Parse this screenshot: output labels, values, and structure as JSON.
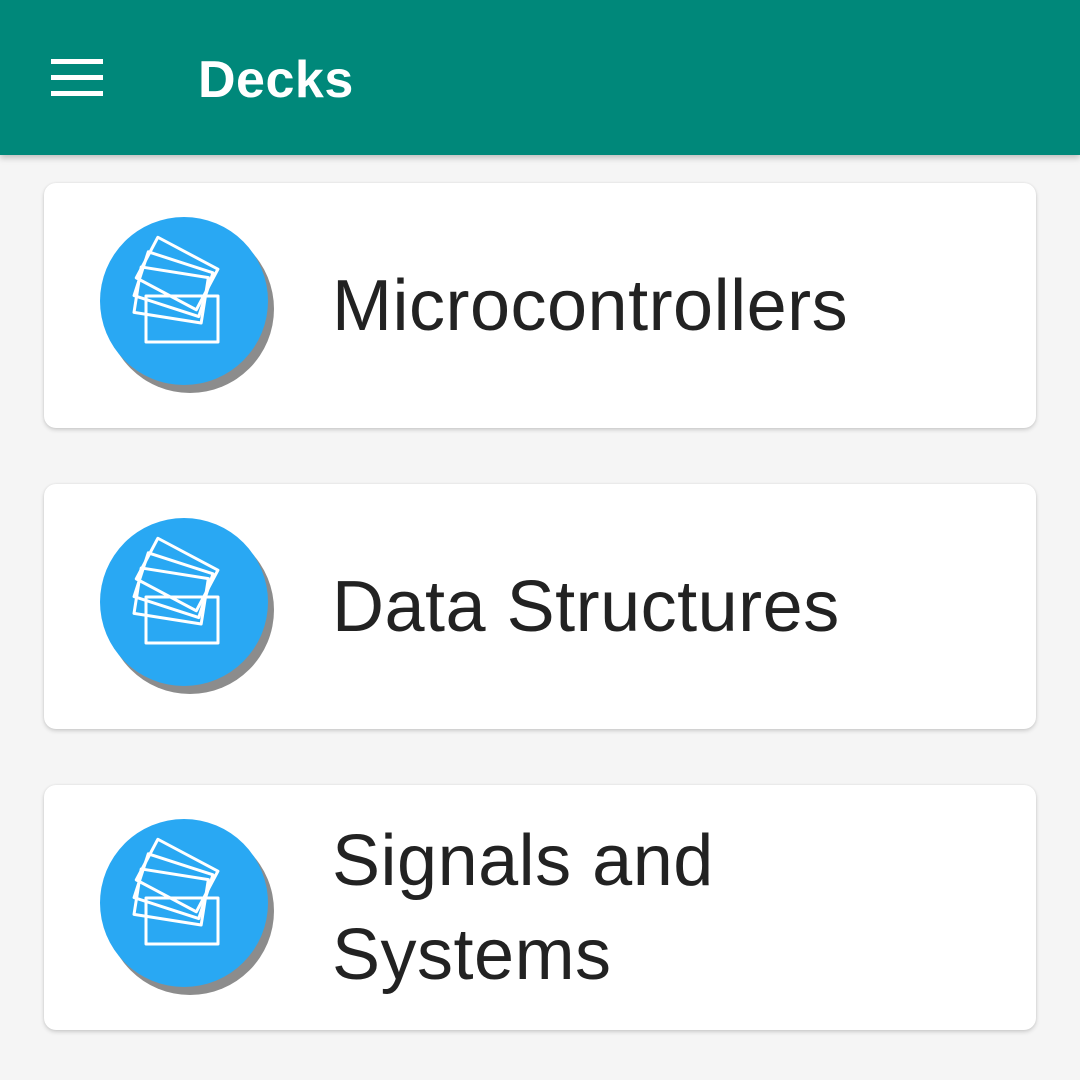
{
  "app_bar": {
    "title": "Decks",
    "menu_icon": "hamburger-menu-icon",
    "color": "#00887a"
  },
  "decks": [
    {
      "name": "Microcontrollers",
      "icon": "cards-deck-icon"
    },
    {
      "name": "Data Structures",
      "icon": "cards-deck-icon"
    },
    {
      "name": "Signals and Systems",
      "icon": "cards-deck-icon"
    }
  ],
  "colors": {
    "avatar": "#29a8f3",
    "background": "#f5f5f5",
    "card": "#ffffff",
    "text": "#222222"
  }
}
